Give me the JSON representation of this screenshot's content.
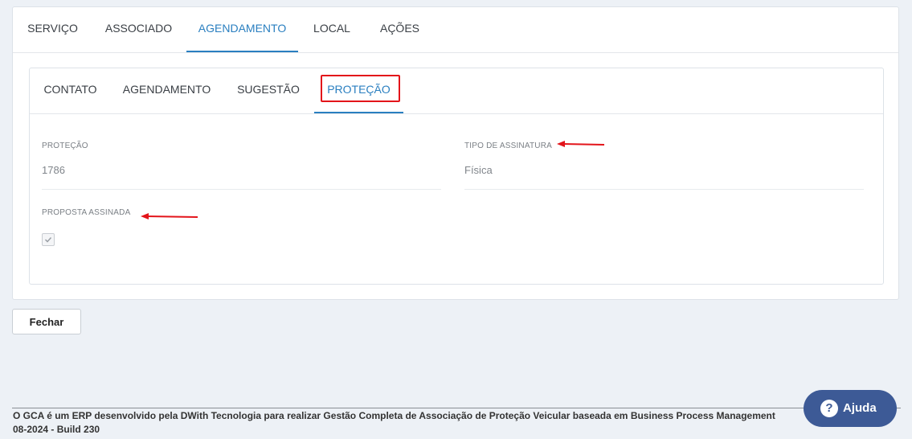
{
  "main_tabs": [
    {
      "label": "SERVIÇO"
    },
    {
      "label": "ASSOCIADO"
    },
    {
      "label": "AGENDAMENTO"
    },
    {
      "label": "LOCAL"
    },
    {
      "label": "AÇÕES"
    }
  ],
  "main_tabs_active": "AGENDAMENTO",
  "sub_tabs": [
    {
      "label": "CONTATO"
    },
    {
      "label": "AGENDAMENTO"
    },
    {
      "label": "SUGESTÃO"
    },
    {
      "label": "PROTEÇÃO"
    }
  ],
  "sub_tabs_active": "PROTEÇÃO",
  "fields": {
    "protecao": {
      "label": "PROTEÇÃO",
      "value": "1786"
    },
    "tipo_assinatura": {
      "label": "TIPO DE ASSINATURA",
      "value": "Física"
    },
    "proposta_assinada": {
      "label": "PROPOSTA ASSINADA",
      "checked": true
    }
  },
  "actions": {
    "close_label": "Fechar"
  },
  "footer": {
    "line1": "O GCA é um ERP desenvolvido pela DWith Tecnologia para realizar Gestão Completa de Associação de Proteção Veicular baseada em Business Process Management",
    "line2": "08-2024 - Build 230"
  },
  "help": {
    "icon_glyph": "?",
    "label": "Ajuda"
  },
  "colors": {
    "accent": "#2a7fc0",
    "highlight": "#e3141a",
    "help_button": "#3d5a96",
    "background": "#edf1f6"
  },
  "icons": [
    "check-icon",
    "help-icon",
    "annotation-arrow"
  ]
}
